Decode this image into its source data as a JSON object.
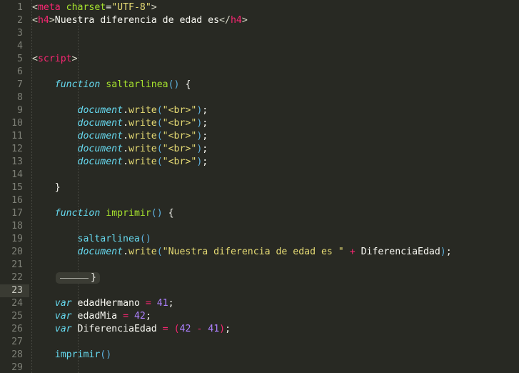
{
  "editor": {
    "theme_name": "monokai",
    "background": "#282923",
    "gutter_text_color": "#7d7f76",
    "current_line": 23,
    "total_lines": 29,
    "fold_marker_line": 22,
    "colors": {
      "tag": "#f92672",
      "attribute": "#a6e22e",
      "string": "#e6db74",
      "keyword": "#66d9ef",
      "function_name": "#a6e22e",
      "function_call": "#66d9ef",
      "number": "#ae81ff",
      "operator": "#f92672",
      "punctuation": "#f8f8f2",
      "current_line_gutter": "#3a3b33",
      "fold_box": "#3b3c34",
      "indent_guide": "#4e4f47"
    },
    "line_numbers": [
      1,
      2,
      3,
      4,
      5,
      6,
      7,
      8,
      9,
      10,
      11,
      12,
      13,
      14,
      15,
      16,
      17,
      18,
      19,
      20,
      21,
      22,
      23,
      24,
      25,
      26,
      27,
      28,
      29
    ],
    "lines": [
      {
        "n": 1,
        "text": "<meta charset=\"UTF-8\">"
      },
      {
        "n": 2,
        "text": "<h4>Nuestra diferencia de edad es</h4>"
      },
      {
        "n": 3,
        "text": ""
      },
      {
        "n": 4,
        "text": ""
      },
      {
        "n": 5,
        "text": "<script>"
      },
      {
        "n": 6,
        "text": ""
      },
      {
        "n": 7,
        "text": "    function saltarlinea() {"
      },
      {
        "n": 8,
        "text": ""
      },
      {
        "n": 9,
        "text": "        document.write(\"<br>\");"
      },
      {
        "n": 10,
        "text": "        document.write(\"<br>\");"
      },
      {
        "n": 11,
        "text": "        document.write(\"<br>\");"
      },
      {
        "n": 12,
        "text": "        document.write(\"<br>\");"
      },
      {
        "n": 13,
        "text": "        document.write(\"<br>\");"
      },
      {
        "n": 14,
        "text": ""
      },
      {
        "n": 15,
        "text": "    }"
      },
      {
        "n": 16,
        "text": ""
      },
      {
        "n": 17,
        "text": "    function imprimir() {"
      },
      {
        "n": 18,
        "text": ""
      },
      {
        "n": 19,
        "text": "        saltarlinea()"
      },
      {
        "n": 20,
        "text": "        document.write(\"Nuestra diferencia de edad es \" + DiferenciaEdad);"
      },
      {
        "n": 21,
        "text": ""
      },
      {
        "n": 22,
        "text": "    }"
      },
      {
        "n": 23,
        "text": ""
      },
      {
        "n": 24,
        "text": "    var edadHermano = 41;"
      },
      {
        "n": 25,
        "text": "    var edadMia = 42;"
      },
      {
        "n": 26,
        "text": "    var DiferenciaEdad = (42 - 41);"
      },
      {
        "n": 27,
        "text": ""
      },
      {
        "n": 28,
        "text": "    imprimir()"
      },
      {
        "n": 29,
        "text": ""
      }
    ],
    "tokens": {
      "l1": {
        "lt": "<",
        "tag": "meta",
        "space": " ",
        "attr": "charset",
        "eq": "=",
        "val": "\"UTF-8\"",
        "gt": ">"
      },
      "l2": {
        "open_lt": "<",
        "open_tag": "h4",
        "open_gt": ">",
        "content": "Nuestra diferencia de edad es",
        "close_lt": "</",
        "close_tag": "h4",
        "close_gt": ">"
      },
      "l5": {
        "lt": "<",
        "tag": "script",
        "gt": ">"
      },
      "l7": {
        "kw": "function",
        "name": "saltarlinea",
        "parens": "()",
        "brace": "{"
      },
      "write": {
        "obj": "document",
        "dot": ".",
        "meth": "write",
        "open": "(",
        "str_br": "\"<br>\"",
        "close": ")",
        "semi": ";"
      },
      "l15": {
        "brace": "}"
      },
      "l17": {
        "kw": "function",
        "name": "imprimir",
        "parens": "()",
        "brace": "{"
      },
      "l19": {
        "call": "saltarlinea",
        "parens": "()"
      },
      "l20": {
        "obj": "document",
        "dot": ".",
        "meth": "write",
        "open": "(",
        "str": "\"Nuestra diferencia de edad es \"",
        "plus": "+",
        "varname": "DiferenciaEdad",
        "close": ")",
        "semi": ";"
      },
      "l22": {
        "brace": "}",
        "fold_rule": ""
      },
      "l24": {
        "kw": "var",
        "name": "edadHermano",
        "eq": "=",
        "num": "41",
        "semi": ";"
      },
      "l25": {
        "kw": "var",
        "name": "edadMia",
        "eq": "=",
        "num": "42",
        "semi": ";"
      },
      "l26": {
        "kw": "var",
        "name": "DiferenciaEdad",
        "eq": "=",
        "open": "(",
        "num1": "42",
        "minus": "-",
        "num2": "41",
        "close": ")",
        "semi": ";"
      },
      "l28": {
        "call": "imprimir",
        "parens": "()"
      }
    }
  }
}
